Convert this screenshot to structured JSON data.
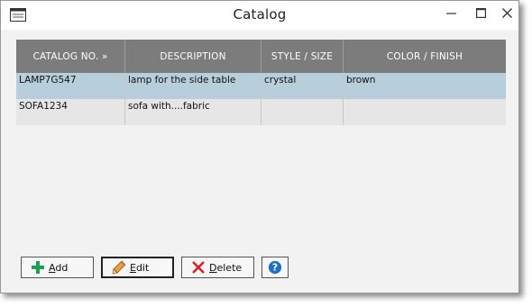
{
  "window": {
    "title": "Catalog"
  },
  "grid": {
    "headers": [
      "CATALOG NO. »",
      "DESCRIPTION",
      "STYLE / SIZE",
      "COLOR / FINISH"
    ],
    "rows": [
      {
        "catalog_no": "LAMP7G547",
        "description": "lamp for the side table",
        "style_size": "crystal",
        "color_finish": "brown"
      },
      {
        "catalog_no": "SOFA1234",
        "description": "sofa with....fabric",
        "style_size": "",
        "color_finish": ""
      }
    ]
  },
  "buttons": {
    "add_first": "A",
    "add_rest": "dd",
    "edit_first": "E",
    "edit_rest": "dit",
    "delete_first": "D",
    "delete_rest": "elete"
  },
  "icons": {
    "app": "window-icon",
    "add": "plus-icon",
    "edit": "pencil-icon",
    "delete": "x-icon",
    "help": "question-icon"
  },
  "colors": {
    "header_bg": "#7c7c7c",
    "selected_row": "#b7cfdb",
    "alt_row": "#e6e6e6",
    "add_icon": "#1aa14a",
    "delete_icon": "#e02020",
    "help_icon": "#1f6fc4"
  }
}
